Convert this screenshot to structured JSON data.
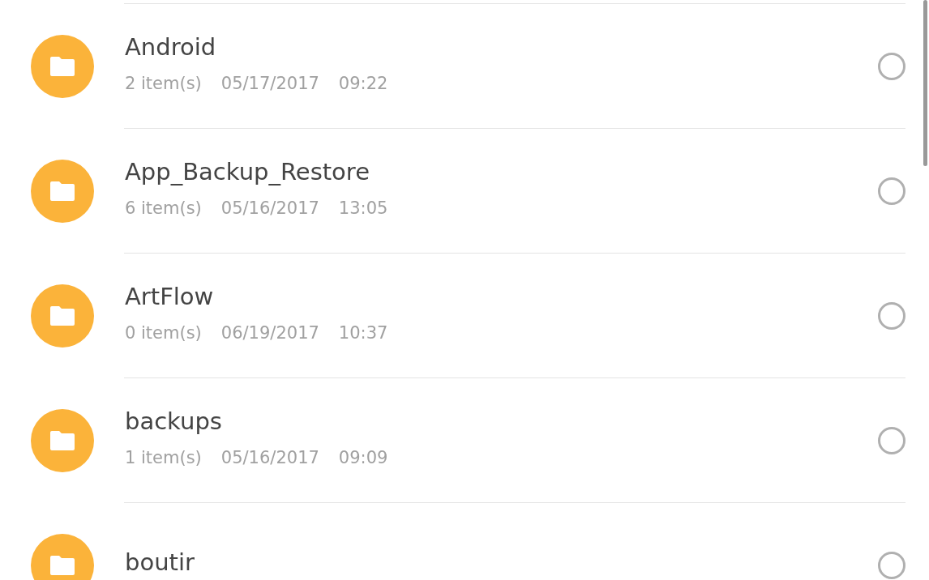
{
  "files": [
    {
      "name": "Android",
      "count": "2 item(s)",
      "date": "05/17/2017",
      "time": "09:22",
      "selected": false
    },
    {
      "name": "App_Backup_Restore",
      "count": "6 item(s)",
      "date": "05/16/2017",
      "time": "13:05",
      "selected": false
    },
    {
      "name": "ArtFlow",
      "count": "0 item(s)",
      "date": "06/19/2017",
      "time": "10:37",
      "selected": false
    },
    {
      "name": "backups",
      "count": "1 item(s)",
      "date": "05/16/2017",
      "time": "09:09",
      "selected": false
    },
    {
      "name": "boutir",
      "selected": false
    }
  ]
}
